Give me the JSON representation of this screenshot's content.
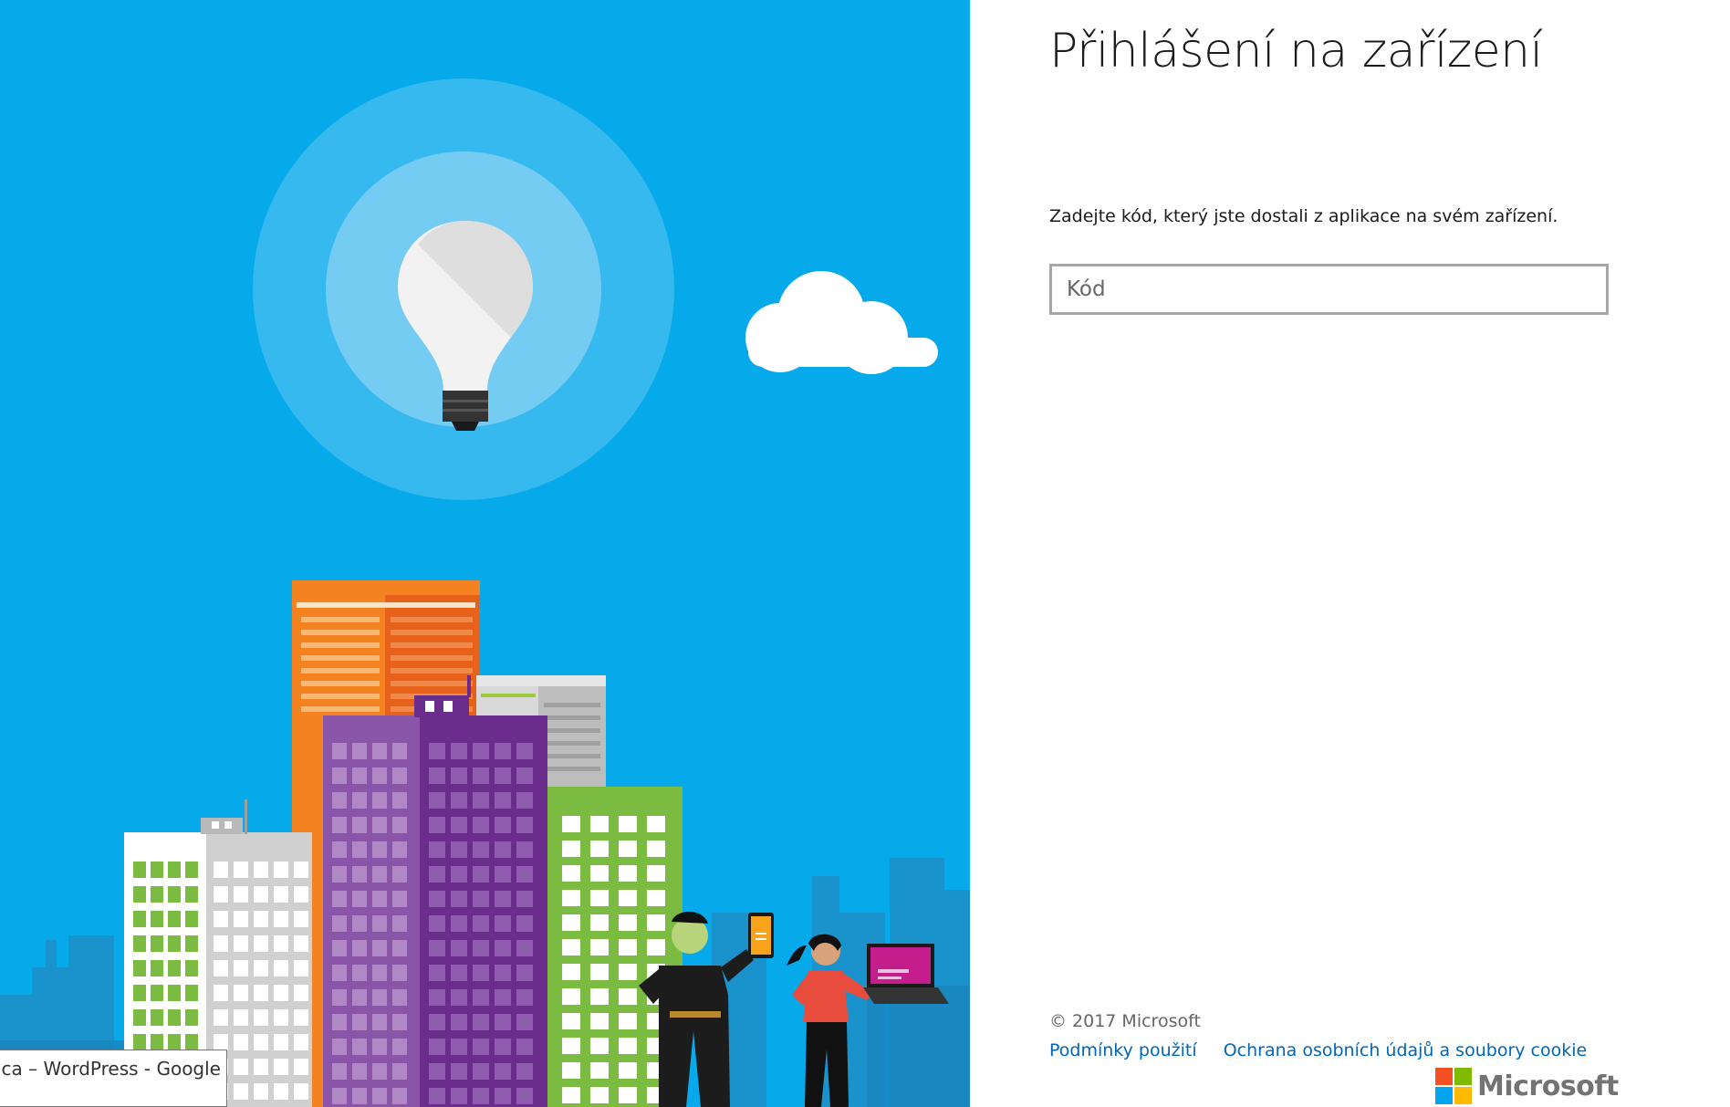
{
  "panel": {
    "title": "Přihlášení na zařízení",
    "instruction": "Zadejte kód, který jste dostali z aplikace na svém zařízení.",
    "code_input": {
      "placeholder": "Kód",
      "value": ""
    }
  },
  "footer": {
    "copyright": "© 2017 Microsoft",
    "links": [
      "Podmínky použití",
      "Ochrana osobních údajů a soubory cookie"
    ],
    "brand": "Microsoft"
  },
  "tooltip": {
    "text": "pica – WordPress - Google"
  },
  "colors": {
    "sky": "#06a9ea",
    "link": "#0067b8",
    "logo_red": "#f25022",
    "logo_green": "#7fba00",
    "logo_blue": "#00a4ef",
    "logo_yellow": "#ffb900"
  }
}
